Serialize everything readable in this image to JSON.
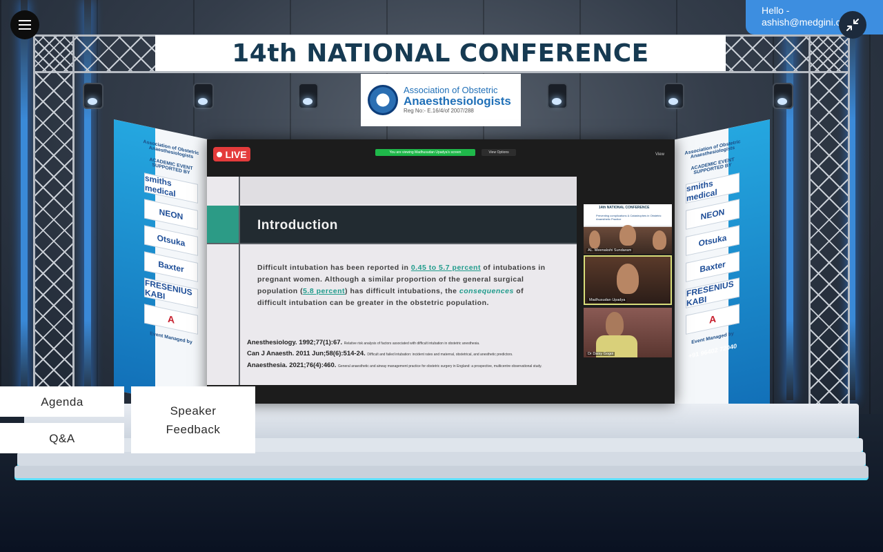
{
  "stage": {
    "banner_title": "14th NATIONAL CONFERENCE",
    "org_logo": {
      "line1": "Association of Obstetric",
      "line2": "Anaesthesiologists",
      "line3": "Reg No:- E.16/4/of 2007/288"
    },
    "left_panel": {
      "org": "Association of Obstetric Anaesthesiologists",
      "supported_by": "ACADEMIC EVENT SUPPORTED BY",
      "sponsors": [
        "smiths medical",
        "NEON",
        "Otsuka",
        "Baxter",
        "FRESENIUS KABI",
        "A"
      ],
      "managed_by": "Event Managed by"
    },
    "right_panel": {
      "org": "Association of Obstetric Anaesthesiologists",
      "supported_by": "ACADEMIC EVENT SUPPORTED BY",
      "sponsors": [
        "smiths medical",
        "NEON",
        "Otsuka",
        "Baxter",
        "FRESENIUS KABI",
        "A"
      ],
      "managed_by": "Event Managed by",
      "phone": "+91 96402 72040"
    }
  },
  "screen": {
    "live_label": "LIVE",
    "viewing_text": "You are viewing Madhusudan Upadya's screen",
    "view_options": "View Options",
    "view_label": "View",
    "slide": {
      "title": "Introduction",
      "body_1": "Difficult intubation has been reported in ",
      "body_hl1": "0.45 to 5.7 percent",
      "body_2": " of intubations in pregnant women. Although a similar proportion of the general surgical population (",
      "body_hl2": "5.8 percent",
      "body_3": ") has difficult intubations, the ",
      "body_em": "consequences",
      "body_4": " of difficult intubation can be greater in the obstetric population.",
      "refs": [
        {
          "cite": "Anesthesiology. 1992;77(1):67.",
          "title": "Relative risk analysis of factors associated with difficult intubation in obstetric anesthesia."
        },
        {
          "cite": "Can J Anaesth. 2011 Jun;58(6):514-24.",
          "title": "Difficult and failed intubation: incident rates and maternal, obstetrical, and anesthetic predictors."
        },
        {
          "cite": "Anaesthesia. 2021;76(4):460.",
          "title": "General anaesthetic and airway management practice for obstetric surgery in England: a prospective, multicentre observational study."
        }
      ]
    },
    "tiles": [
      {
        "name": "AL. Meenakshi Sundaram",
        "header": "14th NATIONAL CONFERENCE",
        "subheader": "Preventing complications & Catastrophes in Obstetric Anaesthetic Practice"
      },
      {
        "name": "Madhusudan Upadya"
      },
      {
        "name": "Dr Daisy Gogoi"
      }
    ]
  },
  "nav": {
    "agenda": "Agenda",
    "qa": "Q&A",
    "feedback": "Speaker Feedback"
  },
  "user": {
    "greeting": "Hello - ashish@medgini.com"
  },
  "icons": {
    "menu": "hamburger-menu-icon",
    "minimize": "minimize-arrows-icon"
  },
  "colors": {
    "live_red": "#e43b3b",
    "accent_blue": "#3d8ee0",
    "slide_teal": "#2c9b86",
    "banner_text": "#163a52"
  }
}
